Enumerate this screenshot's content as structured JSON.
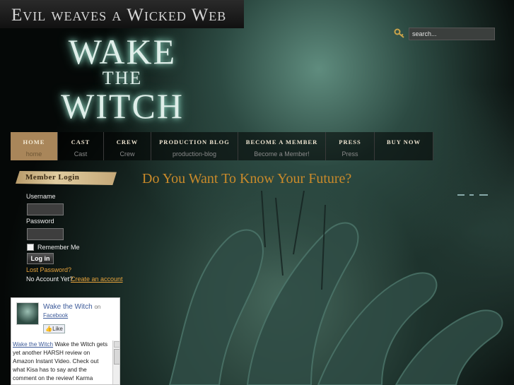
{
  "header": {
    "tagline": "Evil weaves a Wicked Web",
    "logo_line1": "WAKE",
    "logo_line2": "THE",
    "logo_line3": "WITCH"
  },
  "search": {
    "placeholder": "search...",
    "icon": "key-icon"
  },
  "nav": {
    "items": [
      {
        "label": "HOME",
        "sub": "home",
        "active": true
      },
      {
        "label": "CAST",
        "sub": "Cast"
      },
      {
        "label": "CREW",
        "sub": "Crew"
      },
      {
        "label": "PRODUCTION BLOG",
        "sub": "production-blog"
      },
      {
        "label": "BECOME A MEMBER",
        "sub": "Become a Member!"
      },
      {
        "label": "PRESS",
        "sub": "Press"
      },
      {
        "label": "BUY NOW",
        "sub": ""
      }
    ]
  },
  "login": {
    "title": "Member Login",
    "username_label": "Username",
    "password_label": "Password",
    "remember_label": "Remember Me",
    "login_button": "Log in",
    "lost_password": "Lost Password?",
    "no_account": "No Account Yet?",
    "create_account": "Create an account"
  },
  "main": {
    "heading": "Do You Want To Know Your Future?"
  },
  "facebook": {
    "page_name": "Wake the Witch",
    "on": "on",
    "site": "Facebook",
    "like": "Like",
    "post_source": "Wake the Witch",
    "post_text": "Wake the Witch gets yet another HARSH review on Amazon Instant Video. Check out what Kisa has to say and the comment on the review! Karma"
  },
  "colors": {
    "accent": "#c98a2a",
    "nav_active": "#a9865a",
    "link": "#e6a33c"
  }
}
